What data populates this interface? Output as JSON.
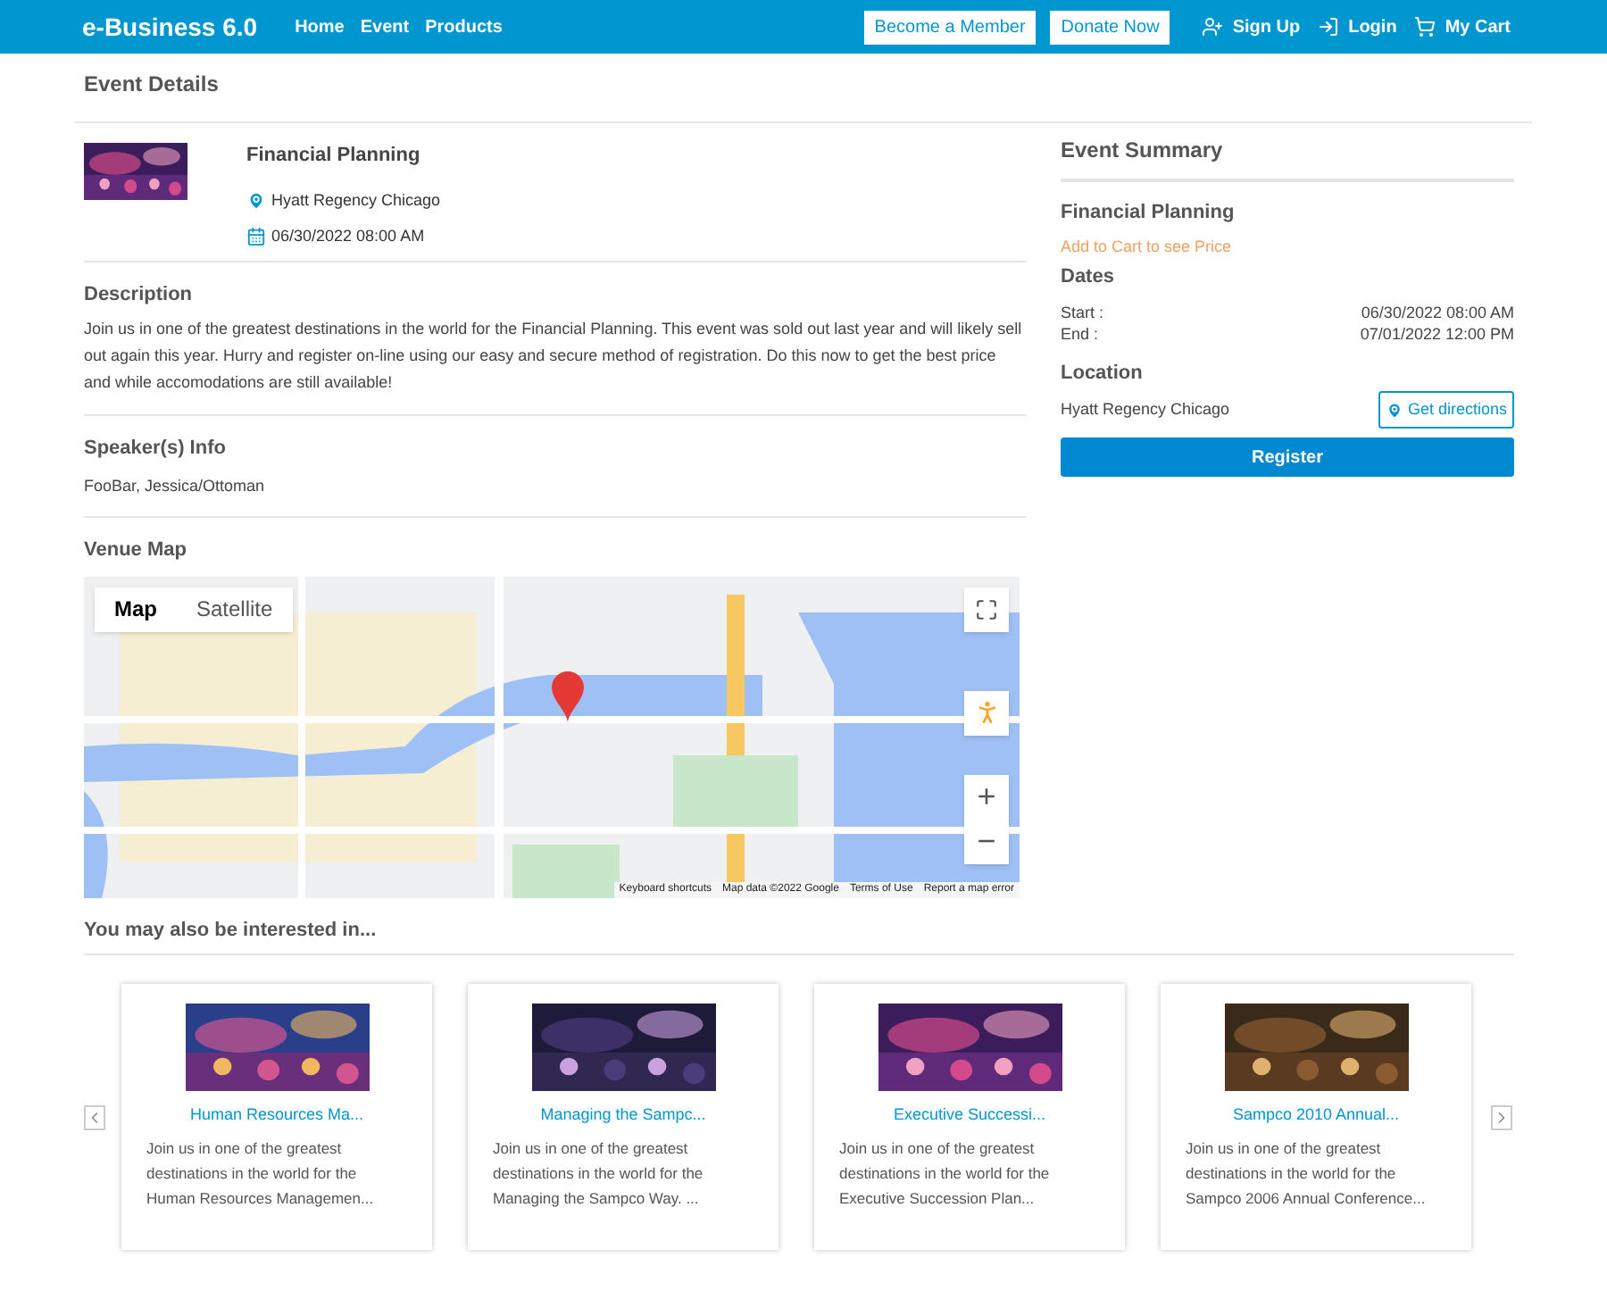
{
  "navbar": {
    "brand": "e-Business 6.0",
    "links": [
      {
        "label": "Home"
      },
      {
        "label": "Event"
      },
      {
        "label": "Products"
      }
    ],
    "buttons": [
      {
        "label": "Become a Member"
      },
      {
        "label": "Donate Now"
      }
    ],
    "actions": [
      {
        "kind": "signup",
        "label": "Sign Up"
      },
      {
        "kind": "login",
        "label": "Login"
      },
      {
        "kind": "cart",
        "label": "My Cart"
      }
    ]
  },
  "page_title": "Event Details",
  "event": {
    "title": "Financial Planning",
    "location": "Hyatt Regency Chicago",
    "date": "06/30/2022 08:00 AM"
  },
  "description": {
    "heading": "Description",
    "text": "Join us in one of the greatest destinations in the world for the Financial Planning. This event was sold out last year and will likely sell out again this year. Hurry and register on-line using our easy and secure method of registration. Do this now to get the best price and while accomodations are still available!"
  },
  "speakers": {
    "heading": "Speaker(s) Info",
    "text": "FooBar, Jessica/Ottoman"
  },
  "venue_map": {
    "heading": "Venue Map",
    "map_types": [
      {
        "label": "Map",
        "selected": true
      },
      {
        "label": "Satellite",
        "selected": false
      }
    ],
    "zoom_in": "+",
    "zoom_out": "−",
    "footer": [
      "Keyboard shortcuts",
      "Map data ©2022 Google",
      "Terms of Use",
      "Report a map error"
    ]
  },
  "summary": {
    "heading": "Event Summary",
    "title": "Financial Planning",
    "price_note": "Add to Cart to see Price",
    "dates_heading": "Dates",
    "dates": [
      {
        "label": "Start :",
        "value": "06/30/2022 08:00 AM"
      },
      {
        "label": "End :",
        "value": "07/01/2022 12:00 PM"
      }
    ],
    "location_heading": "Location",
    "location": "Hyatt Regency Chicago",
    "directions_button": "Get directions",
    "register_button": "Register"
  },
  "related": {
    "heading": "You may also be interested in...",
    "items": [
      {
        "title": "Human Resources Ma...",
        "text": "Join us in one of the greatest destinations in the world for the Human Resources Managemen..."
      },
      {
        "title": "Managing the Sampc...",
        "text": "Join us in one of the greatest destinations in the world for the Managing the Sampco Way. ..."
      },
      {
        "title": "Executive Successi...",
        "text": "Join us in one of the greatest destinations in the world for the Executive Succession Plan..."
      },
      {
        "title": "Sampco 2010 Annual...",
        "text": "Join us in one of the greatest destinations in the world for the Sampco 2006 Annual Conference..."
      }
    ]
  }
}
